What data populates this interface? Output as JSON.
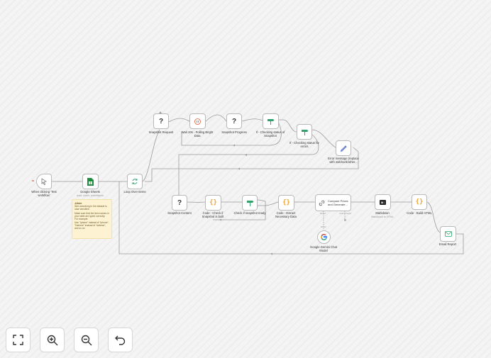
{
  "nodes": {
    "manual_trigger": "When clicking 'Test workflow'",
    "google_sheets": "Google Sheets",
    "google_sheets_sub": "read: sheet, sheetName",
    "loop_over_items": "Loop Over Items",
    "snapshot_request": "Snapshot Request",
    "wait": "Wait 20s - Polling Bright Data",
    "snapshot_progress": "Snapshot Progress",
    "if_checking_status": "If - Checking status of Snapshot",
    "if_checking_errors": "If - Checking status for errors",
    "error_message": "Error message (replace with webhook/other...",
    "snapshot_content": "Snapshot Content",
    "code_check_snapshot": "Code - Check if Snapshot is built",
    "check_snapshot_ready": "Check if snapshot ready",
    "code_extract": "Code - Extract Necessary Data",
    "compare_prices": "Compare Prices and Generate...",
    "compare_model_port": "Model*",
    "compare_parser_port": "Output Parser",
    "gemini_model": "Google Gemini Chat Model",
    "gemini_model_port": "Model",
    "markdown": "Markdown",
    "markdown_sub": "Markdown to HTML",
    "code_build_html": "Code - Build HTML",
    "email_report": "Email Report"
  },
  "sticky_note": {
    "title": "⚠Note",
    "lines": [
      "Item searching in the dataset is case sensitive.",
      "Make sure that the item names in your table are typed correctly.",
      "For example:",
      "Use \"Iphone\" instead of \"iphone\", \"Daforce\" instead of \"daforce\", and so on."
    ]
  },
  "icons": {
    "trigger": "cursor-click-icon",
    "sheets": "google-sheets-icon",
    "loop": "loop-arrows-icon",
    "http": "question-mark-icon",
    "wait": "pause-icon",
    "if": "branch-sign-icon",
    "stop": "pencil-icon",
    "code": "curly-braces-icon",
    "chain": "link-icon",
    "gemini": "google-logo-icon",
    "markdown": "markdown-icon",
    "email": "envelope-icon"
  },
  "colors": {
    "accent_green": "#2fa36b",
    "sheets_green": "#1e8e3e",
    "code_orange": "#f0a22c",
    "error_blue": "#4a62c4",
    "wait_red": "#e05a3b"
  },
  "controls": {
    "fit_view": "fit-view",
    "zoom_in": "zoom-in",
    "zoom_out": "zoom-out",
    "undo": "undo"
  }
}
